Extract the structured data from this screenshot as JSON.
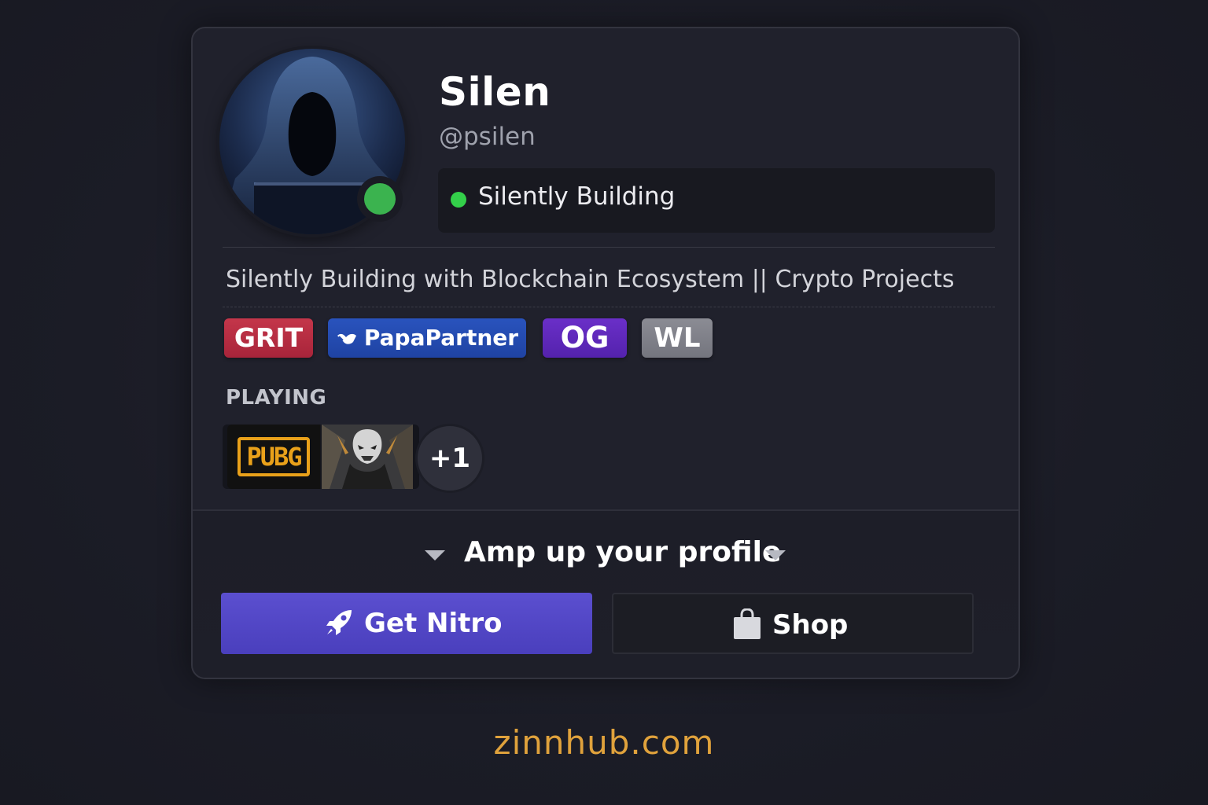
{
  "profile": {
    "display_name": "Silen",
    "username": "@psilen",
    "custom_status": "Silently Building",
    "bio": "Silently Building with Blockchain Ecosystem || Crypto Projects",
    "online_status_color": "#3bb34f"
  },
  "badges": [
    {
      "label": "GRIT",
      "color": "#b82d42"
    },
    {
      "label": "PapaPartner",
      "color": "#244bb0"
    },
    {
      "label": "OG",
      "color": "#5f29bb"
    },
    {
      "label": "WL",
      "color": "#80818a"
    }
  ],
  "playing": {
    "label": "PLAYING",
    "games": [
      {
        "name": "PUBG",
        "logo_text": "PUBG",
        "icon": "pubg-logo-icon"
      },
      {
        "name": "dark-warrior-game",
        "icon": "game-art-icon"
      }
    ],
    "more_label": "+1"
  },
  "amp": {
    "title": "Amp up your profile"
  },
  "buttons": {
    "nitro_label": "Get Nitro",
    "nitro_icon": "rocket-icon",
    "shop_label": "Shop",
    "shop_icon": "shopping-bag-icon",
    "nitro_color": "#5247c6"
  },
  "watermark": "zinnhub.com"
}
